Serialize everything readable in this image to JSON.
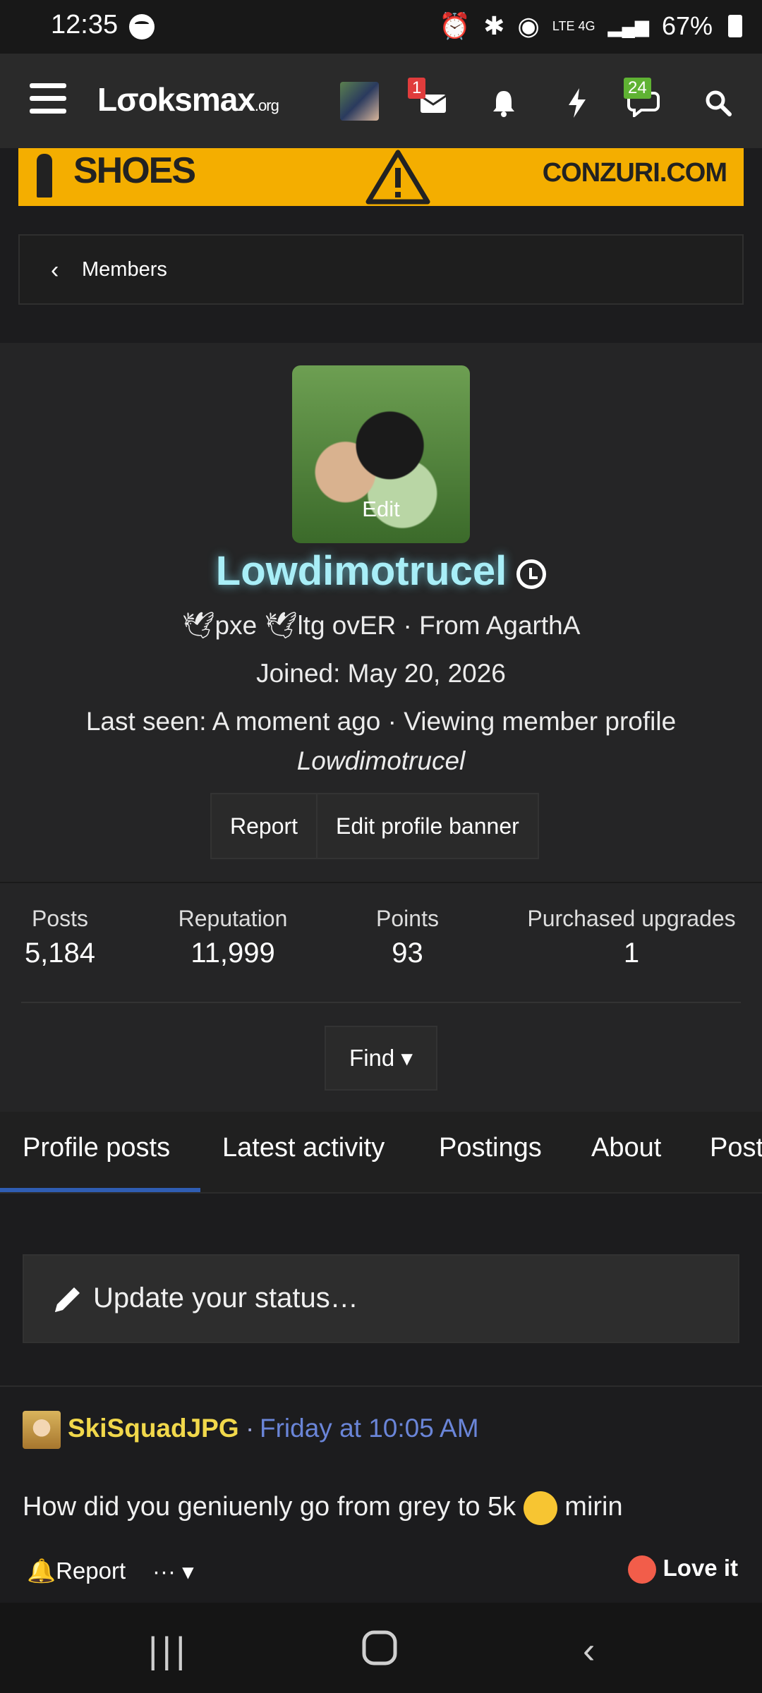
{
  "statusbar": {
    "time": "12:35",
    "battery": "67%",
    "network": "LTE 4G"
  },
  "nav": {
    "logo": "Lσoksmax",
    "logo_suffix": ".org",
    "inbox_badge": "1",
    "alerts_badge": "24"
  },
  "banner": {
    "left_text": "SHOES",
    "right_text": "CONZURI.COM"
  },
  "breadcrumb": {
    "label": "Members"
  },
  "profile": {
    "avatar_edit": "Edit",
    "username": "Lowdimotrucel",
    "title_line": "🕊pxe 🕊ltg ovER · From AgarthA",
    "joined": "Joined: May 20, 2026",
    "last_seen": "Last seen: A moment ago · Viewing member profile",
    "last_seen_target": "Lowdimotrucel",
    "report_btn": "Report",
    "edit_banner_btn": "Edit profile banner"
  },
  "stats": [
    {
      "key": "Posts",
      "value": "5,184"
    },
    {
      "key": "Reputation",
      "value": "11,999"
    },
    {
      "key": "Points",
      "value": "93"
    },
    {
      "key": "Purchased upgrades",
      "value": "1"
    }
  ],
  "find_btn": "Find ▾",
  "tabs": [
    "Profile posts",
    "Latest activity",
    "Postings",
    "About",
    "Post"
  ],
  "status_placeholder": "Update your status…",
  "post": {
    "author": "SkiSquadJPG",
    "separator": "·",
    "time": "Friday at 10:05 AM",
    "body_before": "How did you geniuenly go from grey to 5k",
    "body_after": "mirin",
    "report": "Report",
    "more": "··· ▾",
    "reaction": "Love it"
  },
  "colors": {
    "accent": "#2f5db3",
    "username_glow": "#a8eef7",
    "author": "#f1d84b",
    "link": "#6a85d8",
    "banner": "#f4ae00"
  }
}
